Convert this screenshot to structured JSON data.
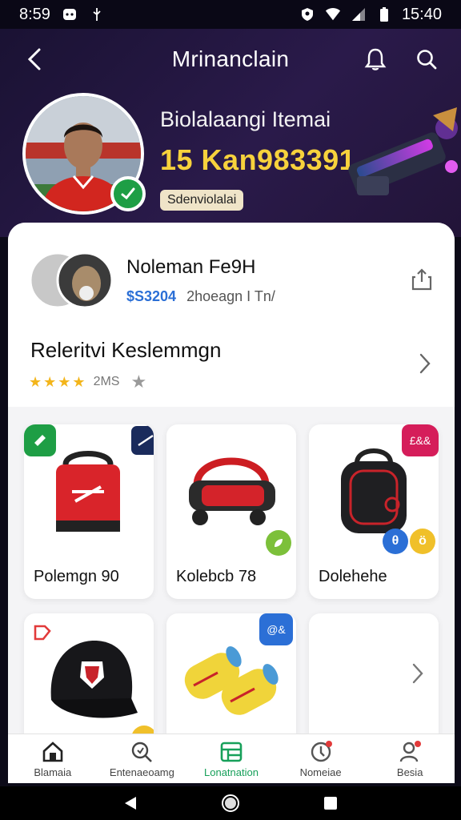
{
  "status_bar": {
    "left_time": "8:59",
    "clock": "15:40",
    "icons": [
      "message-icon",
      "usb-icon",
      "vpn-icon",
      "wifi-icon",
      "signal-icon",
      "battery-icon"
    ]
  },
  "header": {
    "title": "Mrinanclain",
    "back_icon": "back-arrow-icon",
    "actions": [
      "bell-icon",
      "search-icon"
    ]
  },
  "hero": {
    "headline": "Biolalaangi Itemai",
    "price": "15 Kan983391",
    "chip_label": "Sdenviolalai",
    "verified_icon": "check-icon"
  },
  "seller": {
    "name": "Noleman Fe9H",
    "price": "$S3204",
    "sub": "2hoeagn I Tn/",
    "share_icon": "share-icon"
  },
  "rating": {
    "title": "Releritvi Keslemmgn",
    "stars": 4,
    "count": "2MS",
    "fav_icon": "star-icon"
  },
  "products": [
    {
      "label": "Polemgn 90",
      "image": "red-bag-image"
    },
    {
      "label": "Kolebcb 78",
      "image": "massage-gun-image"
    },
    {
      "label": "Dolehehe",
      "image": "black-backpack-image"
    },
    {
      "label": "",
      "image": "black-cap-image"
    },
    {
      "label": "",
      "image": "yellow-rolls-image"
    }
  ],
  "badges": {
    "card3_tag": "£&&",
    "card5_tag": "@&",
    "round_1": "θ",
    "round_2": "ö"
  },
  "bottom_nav": [
    {
      "label": "Blamaia",
      "icon": "home-icon"
    },
    {
      "label": "Entenaeoamg",
      "icon": "search-icon"
    },
    {
      "label": "Lonatnation",
      "icon": "grid-icon"
    },
    {
      "label": "Nomeiae",
      "icon": "alert-icon"
    },
    {
      "label": "Besia",
      "icon": "profile-icon"
    }
  ],
  "colors": {
    "hero_bg": "#2a1a4a",
    "price_yellow": "#f7d23c",
    "accent_green": "#17a05a",
    "link_blue": "#2b6fd6",
    "star_yellow": "#f3b51b"
  }
}
